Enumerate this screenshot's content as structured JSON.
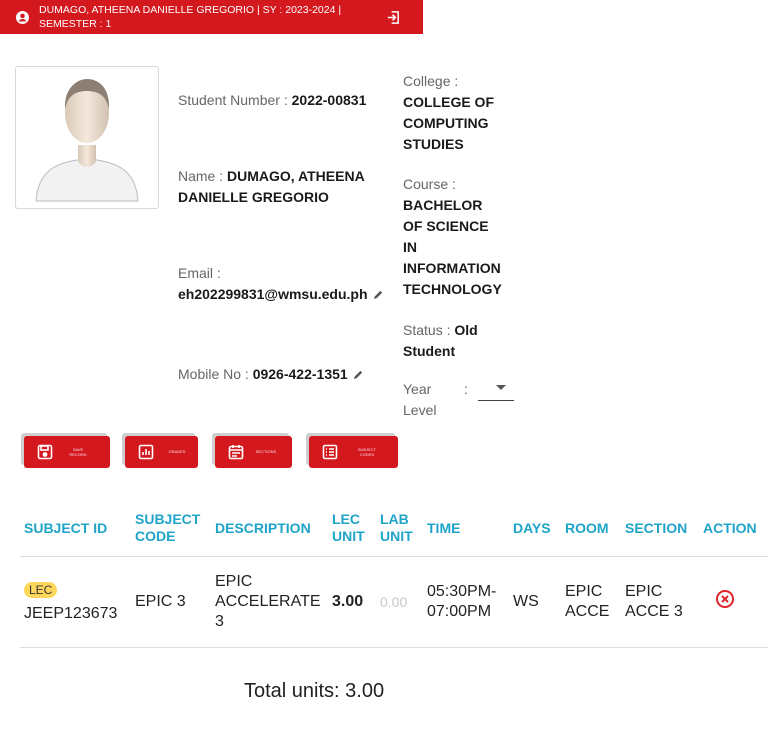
{
  "header": {
    "title": "DUMAGO, ATHEENA DANIELLE GREGORIO | SY : 2023-2024 | SEMESTER : 1",
    "icons": {
      "user": "user-circle-icon",
      "logout": "logout-icon"
    },
    "bg_color": "#d3181e"
  },
  "student": {
    "number_label": "Student Number :",
    "number": "2022-00831",
    "name_label": "Name :",
    "name": "DUMAGO, ATHEENA DANIELLE GREGORIO",
    "email_label": "Email :",
    "email": "eh202299831@wmsu.edu.ph",
    "mobile_label": "Mobile No :",
    "mobile": "0926-422-1351",
    "college_label": "College :",
    "college": "COLLEGE OF COMPUTING STUDIES",
    "course_label": "Course :",
    "course": "BACHELOR OF SCIENCE IN INFORMATION TECHNOLOGY",
    "status_label": "Status :",
    "status": "Old Student",
    "year_level_label": "Year Level",
    "year_level_sep": ":",
    "year_level_value": ""
  },
  "actions": [
    {
      "label": "SAVE RECORD",
      "icon": "save-icon"
    },
    {
      "label": "GRADES",
      "icon": "chart-icon"
    },
    {
      "label": "SECTIONS",
      "icon": "calendar-icon"
    },
    {
      "label": "SUBJECT CODES",
      "icon": "list-icon"
    }
  ],
  "table": {
    "headers": [
      "SUBJECT ID",
      "SUBJECT CODE",
      "DESCRIPTION",
      "LEC UNIT",
      "LAB UNIT",
      "TIME",
      "DAYS",
      "ROOM",
      "SECTION",
      "ACTION"
    ],
    "rows": [
      {
        "badge": "LEC",
        "subject_id": "JEEP123673",
        "subject_code": "EPIC 3",
        "description": "EPIC ACCELERATE 3",
        "lec_unit": "3.00",
        "lab_unit": "0.00",
        "time": "05:30PM-07:00PM",
        "days": "WS",
        "room": "EPIC ACCE",
        "section": "EPIC ACCE 3",
        "action_icon": "remove-circle-icon"
      }
    ]
  },
  "total": "Total units: 3.00",
  "colors": {
    "accent": "#d3181e",
    "header_text": "#1fa4c9",
    "badge": "#ffd75a"
  }
}
